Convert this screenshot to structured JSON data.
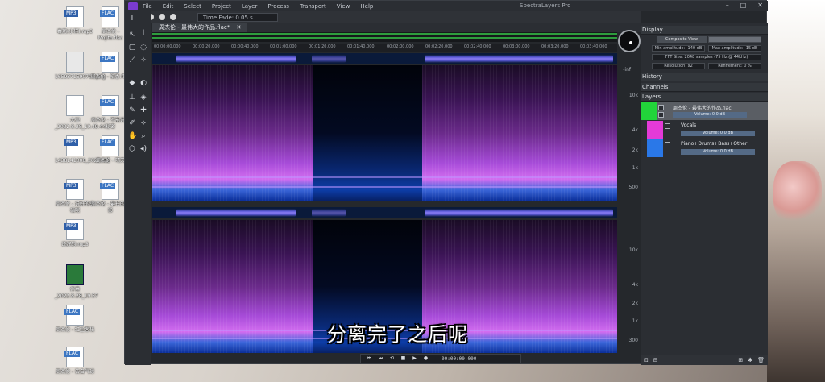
{
  "desktop": {
    "icons": [
      {
        "kind": "mp3",
        "tag": "MP3",
        "label": "毒药(小样).mp3"
      },
      {
        "kind": "flac",
        "tag": "FLAC",
        "label": "周杰伦 - Mojito.flac"
      },
      {
        "kind": "img",
        "tag": "",
        "label": "1659371590700.png"
      },
      {
        "kind": "flac",
        "tag": "FLAC",
        "label": "周杰伦 - 稻香.flac"
      },
      {
        "kind": "doc",
        "tag": "",
        "label": "大弹_2022.8.28_19.49.44"
      },
      {
        "kind": "flac",
        "tag": "FLAC",
        "label": "周杰伦 - 不能说的秘密"
      },
      {
        "kind": "mp3",
        "tag": "MP3",
        "label": "1438141008_2022062"
      },
      {
        "kind": "flac",
        "tag": "FLAC",
        "label": "周杰伦 - 晴天"
      },
      {
        "kind": "mp3",
        "tag": "MP3",
        "label": "周杰伦 - 说好的幸福呢"
      },
      {
        "kind": "flac",
        "tag": "FLAC",
        "label": "周杰伦 - 最长的电影"
      },
      {
        "kind": "mp3",
        "tag": "MP3",
        "label": "说好的.mp3"
      },
      {
        "kind": "green",
        "tag": "",
        "label": "伴奏_2022.8.28_19.57"
      },
      {
        "kind": "flac",
        "tag": "FLAC",
        "label": "周杰伦 - 红尘客栈"
      },
      {
        "kind": "flac",
        "tag": "FLAC",
        "label": "周杰伦 - 告白气球"
      }
    ]
  },
  "app": {
    "window_title": "SpectraLayers Pro",
    "menu": [
      "File",
      "Edit",
      "Select",
      "Project",
      "Layer",
      "Process",
      "Transport",
      "View",
      "Help"
    ],
    "time_fade_label": "Time Fade: 0.05 s",
    "tab_label": "周杰伦 - 最伟大的作品.flac*",
    "ruler_ticks": [
      "00:00:00.000",
      "00:00:20.000",
      "00:00:40.000",
      "00:01:00.000",
      "00:01:20.000",
      "00:01:40.000",
      "00:02:00.000",
      "00:02:20.000",
      "00:02:40.000",
      "00:03:00.000",
      "00:03:20.000",
      "00:03:40.000"
    ],
    "freq_labels": [
      "10k",
      "4k",
      "2k",
      "1k",
      "500",
      "300"
    ],
    "db_label": "-inf",
    "transport": {
      "buttons": [
        "⏮",
        "⏭",
        "⟲",
        "■",
        "▶",
        "●"
      ],
      "time": "00:00:00.000"
    },
    "subtitle": "分离完了之后呢"
  },
  "panel": {
    "display_header": "Display",
    "composite_view": "Composite View",
    "min_amplitude": "Min amplitude: -140 dB",
    "max_amplitude": "Max amplitude: -15 dB",
    "fft_size": "FFT Size: 2048 samples (75 Hz @ 44kHz)",
    "resolution": "Resolution: x2",
    "refinement": "Refinement: 0 %",
    "history_header": "History",
    "channels_header": "Channels",
    "layers_header": "Layers",
    "layers": [
      {
        "name": "周杰伦 - 最伟大的作品.flac",
        "volume": "Volume: 0.0 dB",
        "color": "#22d43a"
      },
      {
        "name": "Vocals",
        "volume": "Volume: 0.0 dB",
        "color": "#e43ad8"
      },
      {
        "name": "Piano+Drums+Bass+Other",
        "volume": "Volume: 0.0 dB",
        "color": "#2a78e8"
      }
    ]
  }
}
